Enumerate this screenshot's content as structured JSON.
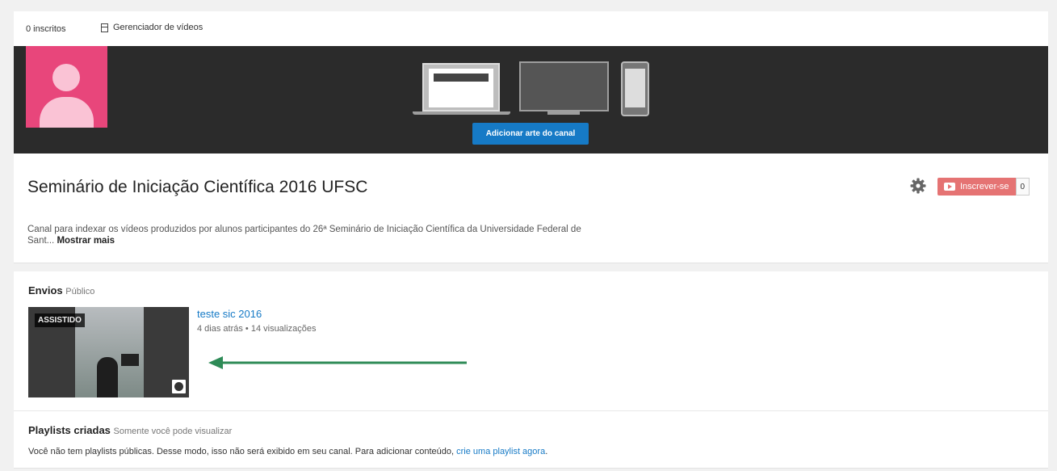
{
  "header": {
    "subscribers": "0 inscritos",
    "video_manager": "Gerenciador de vídeos"
  },
  "banner": {
    "add_art_label": "Adicionar arte do canal"
  },
  "channel": {
    "title": "Seminário de Iniciação Científica 2016 UFSC",
    "subscribe_label": "Inscrever-se",
    "subscribe_count": "0",
    "description_line1": "Canal para indexar os vídeos produzidos por alunos participantes do 26ª Seminário de Iniciação Científica da Universidade Federal de",
    "description_line2": "Sant...",
    "show_more": "Mostrar mais"
  },
  "uploads": {
    "title": "Envios",
    "visibility": "Público",
    "video": {
      "watched_badge": "ASSISTIDO",
      "title": "teste sic 2016",
      "meta": "4 dias atrás • 14 visualizações"
    }
  },
  "playlists": {
    "title": "Playlists criadas",
    "subtitle": "Somente você pode visualizar",
    "text": "Você não tem playlists públicas. Desse modo, isso não será exibido em seu canal. Para adicionar conteúdo, ",
    "link": "crie uma playlist agora",
    "text_end": "."
  },
  "colors": {
    "accent": "#167ac6",
    "avatar": "#e8467b",
    "subscribe": "#e57373",
    "arrow": "#2e8b57"
  },
  "icons": [
    "video-manager-icon",
    "gear-icon",
    "play-icon",
    "clock-icon",
    "arrow-left-icon"
  ]
}
